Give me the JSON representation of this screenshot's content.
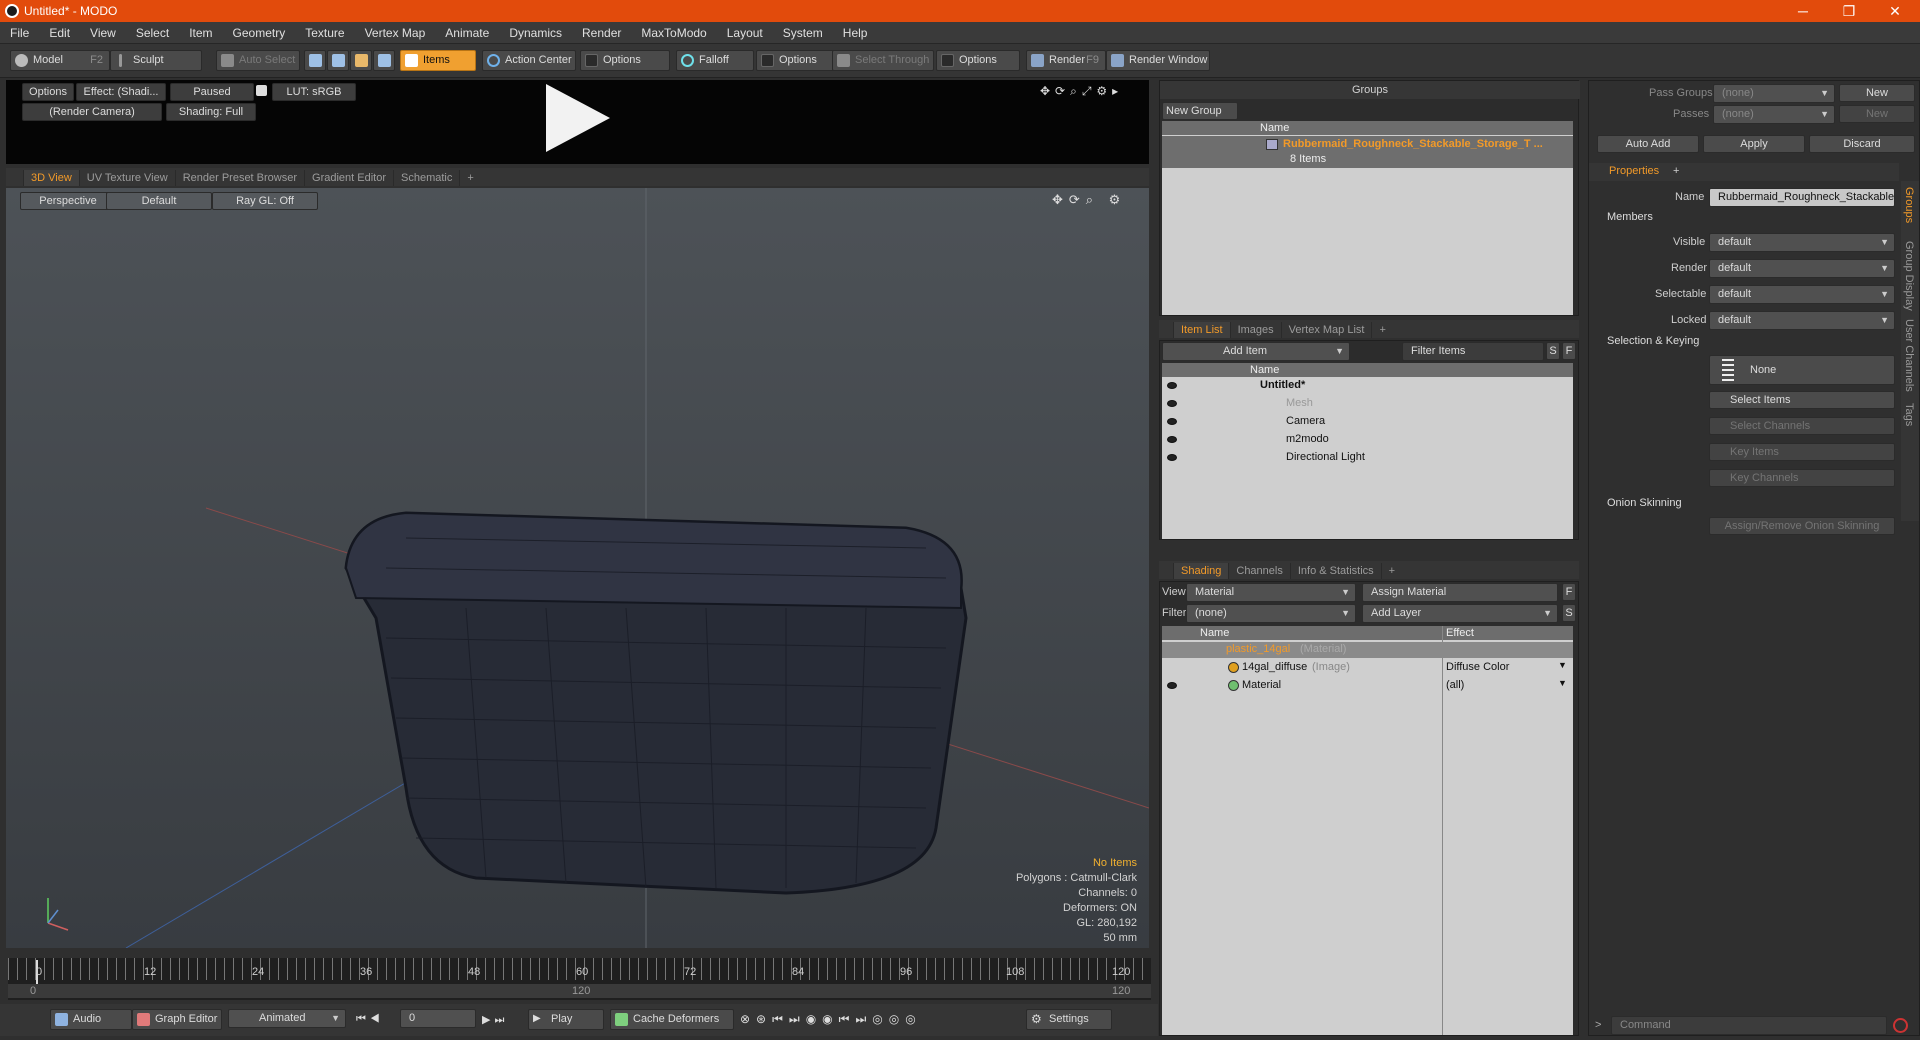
{
  "window": {
    "title": "Untitled* - MODO",
    "minimize": "─",
    "maximize": "❐",
    "close": "✕"
  },
  "menu": [
    "File",
    "Edit",
    "View",
    "Select",
    "Item",
    "Geometry",
    "Texture",
    "Vertex Map",
    "Animate",
    "Dynamics",
    "Render",
    "MaxToModo",
    "Layout",
    "System",
    "Help"
  ],
  "toolbar": {
    "model": "Model",
    "model_key": "F2",
    "sculpt": "Sculpt",
    "auto_select": "Auto Select",
    "items": "Items",
    "action_center": "Action Center",
    "options1": "Options",
    "falloff": "Falloff",
    "options2": "Options",
    "select_through": "Select Through",
    "options3": "Options",
    "render": "Render",
    "render_key": "F9",
    "render_window": "Render Window"
  },
  "preview": {
    "options": "Options",
    "effect": "Effect: (Shadi...",
    "paused": "Paused",
    "lut": "LUT: sRGB",
    "camera": "(Render Camera)",
    "shading": "Shading: Full"
  },
  "viewport_tabs": [
    "3D View",
    "UV Texture View",
    "Render Preset Browser",
    "Gradient Editor",
    "Schematic",
    "+"
  ],
  "viewport": {
    "perspective": "Perspective",
    "default": "Default",
    "raygl": "Ray GL: Off",
    "info": {
      "no_items": "No Items",
      "polygons": "Polygons : Catmull-Clark",
      "channels": "Channels: 0",
      "deformers": "Deformers: ON",
      "gl": "GL: 280,192",
      "lens": "50 mm"
    }
  },
  "timeline": {
    "ticks": [
      "0",
      "12",
      "24",
      "36",
      "48",
      "60",
      "72",
      "84",
      "96",
      "108",
      "120"
    ],
    "sub_start": "0",
    "sub_mid": "120",
    "sub_end": "120"
  },
  "bottom": {
    "audio": "Audio",
    "graph_editor": "Graph Editor",
    "animated": "Animated",
    "frame": "0",
    "play": "Play",
    "cache": "Cache Deformers",
    "settings": "Settings"
  },
  "groups": {
    "title": "Groups",
    "new_group": "New Group",
    "col_name": "Name",
    "item_name": "Rubbermaid_Roughneck_Stackable_Storage_T ...",
    "item_count": "8 Items"
  },
  "item_list": {
    "tabs": [
      "Item List",
      "Images",
      "Vertex Map List",
      "+"
    ],
    "add_item": "Add Item",
    "filter": "Filter Items",
    "s": "S",
    "f": "F",
    "col_name": "Name",
    "rows": [
      {
        "name": "Untitled*"
      },
      {
        "name": "Mesh"
      },
      {
        "name": "Camera"
      },
      {
        "name": "m2modo"
      },
      {
        "name": "Directional Light"
      }
    ]
  },
  "shading": {
    "tabs": [
      "Shading",
      "Channels",
      "Info & Statistics",
      "+"
    ],
    "view_label": "View",
    "view_value": "Material",
    "assign_material": "Assign Material",
    "f": "F",
    "filter_label": "Filter",
    "filter_value": "(none)",
    "add_layer": "Add Layer",
    "s": "S",
    "col_name": "Name",
    "col_effect": "Effect",
    "rows": [
      {
        "name": "plastic_14gal",
        "type": "(Material)",
        "effect": ""
      },
      {
        "name": "14gal_diffuse",
        "type": "(Image)",
        "effect": "Diffuse Color"
      },
      {
        "name": "Material",
        "type": "",
        "effect": "(all)"
      }
    ]
  },
  "props": {
    "pass_groups": "Pass Groups",
    "passes": "Passes",
    "none1": "(none)",
    "none2": "(none)",
    "new1": "New",
    "new2": "New",
    "auto_add": "Auto Add",
    "apply": "Apply",
    "discard": "Discard",
    "tab": "Properties",
    "plus": "+",
    "name_label": "Name",
    "name_value": "Rubbermaid_Roughneck_Stackable_",
    "members": "Members",
    "visible": "Visible",
    "render": "Render",
    "selectable": "Selectable",
    "locked": "Locked",
    "default_val": "default",
    "sel_keying": "Selection & Keying",
    "none_btn": "None",
    "select_items": "Select Items",
    "select_channels": "Select Channels",
    "key_items": "Key Items",
    "key_channels": "Key Channels",
    "onion": "Onion Skinning",
    "assign_onion": "Assign/Remove Onion Skinning",
    "side_tabs": [
      "Groups",
      "Group Display",
      "User Channels",
      "Tags"
    ],
    "command": "Command"
  },
  "colors": {
    "accent": "#f29a29",
    "titlebar": "#e24b0c"
  }
}
